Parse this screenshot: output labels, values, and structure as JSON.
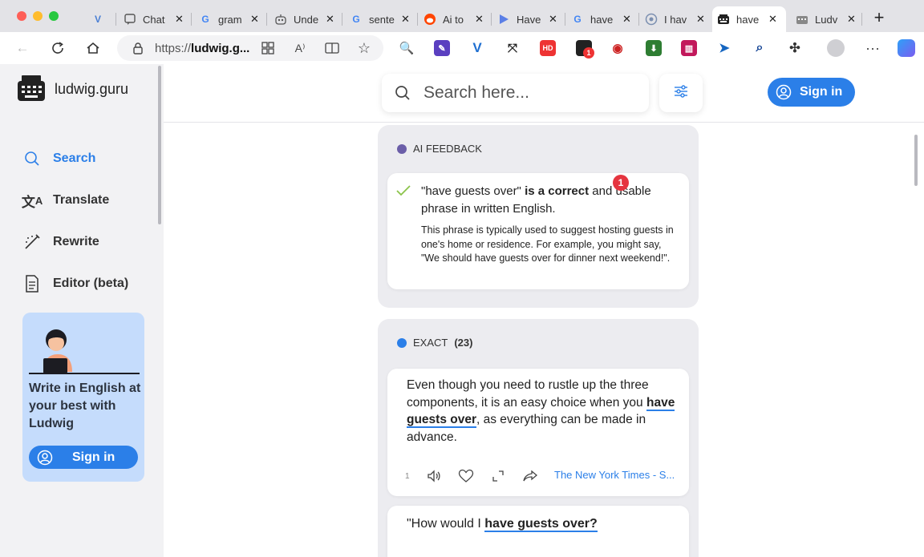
{
  "browser": {
    "tabs": [
      {
        "title": "",
        "icon": "v-extension-icon"
      },
      {
        "title": "Chat",
        "icon": "chat-icon"
      },
      {
        "title": "gram",
        "icon": "google-icon"
      },
      {
        "title": "Unde",
        "icon": "robot-icon"
      },
      {
        "title": "sente",
        "icon": "google-icon"
      },
      {
        "title": "Ai to",
        "icon": "reddit-icon"
      },
      {
        "title": "Have",
        "icon": "play-icon"
      },
      {
        "title": "have",
        "icon": "google-icon"
      },
      {
        "title": "I hav",
        "icon": "chrome-icon"
      },
      {
        "title": "have",
        "icon": "keyboard-icon"
      },
      {
        "title": "Ludv",
        "icon": "keyboard-icon"
      }
    ],
    "url_prefix": "https://",
    "url_domain": "ludwig.g...",
    "ext_badge": "1"
  },
  "sidebar": {
    "brand": "ludwig.guru",
    "nav": [
      {
        "label": "Search",
        "icon": "search-icon"
      },
      {
        "label": "Translate",
        "icon": "translate-icon"
      },
      {
        "label": "Rewrite",
        "icon": "rewrite-icon"
      },
      {
        "label": "Editor (beta)",
        "icon": "document-icon"
      }
    ],
    "promo": {
      "text": "Write in English at your best with Ludwig",
      "button": "Sign in"
    }
  },
  "header": {
    "search_placeholder": "Search here...",
    "signin_label": "Sign in"
  },
  "feedback": {
    "heading": "AI FEEDBACK",
    "quote": "\"have guests over\"",
    "verdict": "is a correct",
    "rest": "and usable phrase in written English.",
    "detail": "This phrase is typically used to suggest hosting guests in one's home or residence. For example, you might say, \"We should have guests over for dinner next weekend!\".",
    "badge": "1"
  },
  "exact": {
    "heading": "EXACT",
    "count": "(23)",
    "examples": [
      {
        "before": "Even though you need to rustle up the three components, it is an easy choice when you ",
        "highlight": "have guests over",
        "after": ", as everything can be made in advance.",
        "index": "1",
        "source": "The New York Times - S..."
      },
      {
        "before": "\"How would I ",
        "highlight": "have guests over?",
        "after": ""
      }
    ]
  },
  "colors": {
    "accent": "#2b7fe8",
    "feedback_dot": "#6b5ea8",
    "badge": "#e5343f"
  }
}
